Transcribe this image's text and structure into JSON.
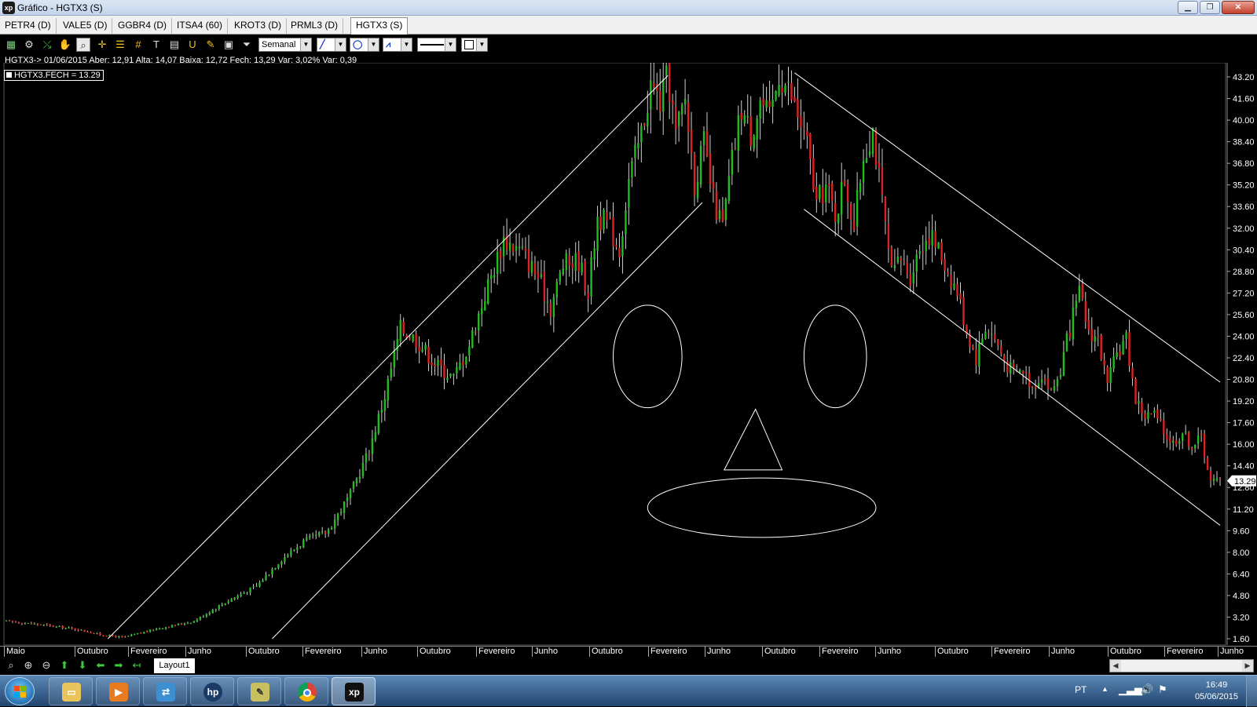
{
  "window": {
    "title": "Gráfico - HGTX3 (S)",
    "app_icon_text": "xp",
    "minimize_label": "▁",
    "restore_label": "❐",
    "close_label": "✕"
  },
  "tabs": [
    {
      "label": "PETR4 (D)"
    },
    {
      "label": "VALE5 (D)"
    },
    {
      "label": "GGBR4 (D)"
    },
    {
      "label": "ITSA4 (60)"
    },
    {
      "label": "KROT3 (D)"
    },
    {
      "label": "PRML3 (D)"
    },
    {
      "label": "HGTX3 (S)",
      "active": true
    }
  ],
  "toolbar": {
    "period_value": "Semanal",
    "tools": [
      "chart-type-icon",
      "settings-gear-icon",
      "indicator-icon",
      "pan-hand-icon",
      "magnifier-icon",
      "crosshair-icon",
      "fibonacci-icon",
      "grid-icon",
      "text-icon",
      "calculator-icon",
      "magnet-icon",
      "eraser-icon",
      "lock-icon",
      "filter-icon"
    ]
  },
  "info": {
    "quote_line": "HGTX3-> 01/06/2015 Aber: 12,91 Alta: 14,07 Baixa: 12,72 Fech: 13,29 Var: 3,02% Var: 0,39",
    "legend": "HGTX3.FECH = 13.29"
  },
  "chart_data": {
    "type": "candlestick",
    "symbol": "HGTX3",
    "period": "Semanal",
    "ylim": [
      1.6,
      43.2
    ],
    "y_ticks": [
      "43.20",
      "41.60",
      "40.00",
      "38.40",
      "36.80",
      "35.20",
      "33.60",
      "32.00",
      "30.40",
      "28.80",
      "27.20",
      "25.60",
      "24.00",
      "22.40",
      "20.80",
      "19.20",
      "17.60",
      "16.00",
      "14.40",
      "12.80",
      "11.20",
      "9.60",
      "8.00",
      "6.40",
      "4.80",
      "3.20",
      "1.60"
    ],
    "last_price": "13.29",
    "x_labels": [
      "Maio",
      "Outubro",
      "Fevereiro",
      "Junho",
      "Outubro",
      "Fevereiro",
      "Junho",
      "Outubro",
      "Fevereiro",
      "Junho",
      "Outubro",
      "Fevereiro",
      "Junho",
      "Outubro",
      "Fevereiro",
      "Junho",
      "Outubro",
      "Fevereiro",
      "Junho",
      "Outubro",
      "Fevereiro",
      "Junho"
    ],
    "up_color": "#22bb22",
    "down_color": "#dd2222",
    "line_color": "#ffffff",
    "price_path": [
      [
        0,
        2.9
      ],
      [
        25,
        2.6
      ],
      [
        45,
        2.3
      ],
      [
        60,
        1.9
      ],
      [
        75,
        1.7
      ],
      [
        95,
        2.3
      ],
      [
        120,
        2.9
      ],
      [
        140,
        4.3
      ],
      [
        160,
        5.5
      ],
      [
        175,
        7.4
      ],
      [
        190,
        8.8
      ],
      [
        205,
        9.5
      ],
      [
        220,
        12.3
      ],
      [
        232,
        15.6
      ],
      [
        242,
        19.6
      ],
      [
        252,
        24.6
      ],
      [
        262,
        23.8
      ],
      [
        274,
        22.0
      ],
      [
        286,
        20.9
      ],
      [
        296,
        23.4
      ],
      [
        306,
        27.1
      ],
      [
        318,
        31.2
      ],
      [
        330,
        30.2
      ],
      [
        340,
        28.4
      ],
      [
        348,
        26.1
      ],
      [
        356,
        29.3
      ],
      [
        366,
        29.6
      ],
      [
        372,
        27.3
      ],
      [
        378,
        32.9
      ],
      [
        385,
        32.2
      ],
      [
        392,
        30.4
      ],
      [
        398,
        35.6
      ],
      [
        405,
        38.5
      ],
      [
        412,
        42.6
      ],
      [
        418,
        41.3
      ],
      [
        423,
        43.3
      ],
      [
        428,
        38.9
      ],
      [
        434,
        41.6
      ],
      [
        440,
        35.4
      ],
      [
        446,
        38.2
      ],
      [
        452,
        34.0
      ],
      [
        458,
        32.1
      ],
      [
        464,
        37.0
      ],
      [
        470,
        40.9
      ],
      [
        476,
        39.0
      ],
      [
        482,
        41.5
      ],
      [
        488,
        40.0
      ],
      [
        494,
        43.5
      ],
      [
        500,
        42.3
      ],
      [
        506,
        40.4
      ],
      [
        512,
        38.1
      ],
      [
        518,
        33.8
      ],
      [
        524,
        35.1
      ],
      [
        530,
        33.0
      ],
      [
        536,
        35.7
      ],
      [
        542,
        32.1
      ],
      [
        548,
        37.5
      ],
      [
        554,
        39.4
      ],
      [
        560,
        33.8
      ],
      [
        566,
        28.5
      ],
      [
        572,
        29.7
      ],
      [
        578,
        28.5
      ],
      [
        584,
        30.6
      ],
      [
        590,
        31.6
      ],
      [
        596,
        30.4
      ],
      [
        602,
        28.8
      ],
      [
        608,
        27.3
      ],
      [
        614,
        24.4
      ],
      [
        620,
        22.4
      ],
      [
        626,
        24.7
      ],
      [
        632,
        23.8
      ],
      [
        638,
        22.2
      ],
      [
        644,
        21.2
      ],
      [
        650,
        21.5
      ],
      [
        656,
        20.3
      ],
      [
        662,
        21.3
      ],
      [
        668,
        19.8
      ],
      [
        674,
        21.5
      ],
      [
        680,
        24.6
      ],
      [
        686,
        27.1
      ],
      [
        692,
        24.4
      ],
      [
        698,
        23.8
      ],
      [
        704,
        20.3
      ],
      [
        710,
        22.7
      ],
      [
        716,
        23.8
      ],
      [
        722,
        19.3
      ],
      [
        728,
        18.1
      ],
      [
        734,
        18.2
      ],
      [
        740,
        16.9
      ],
      [
        746,
        16.1
      ],
      [
        752,
        16.9
      ],
      [
        758,
        15.9
      ],
      [
        764,
        16.5
      ],
      [
        770,
        13.2
      ],
      [
        776,
        13.3
      ]
    ],
    "annotations": [
      {
        "kind": "trend-line",
        "from": [
          65,
          1.6
        ],
        "to": [
          423,
          43.3
        ]
      },
      {
        "kind": "trend-line",
        "from": [
          170,
          1.6
        ],
        "to": [
          445,
          33.9
        ]
      },
      {
        "kind": "trend-line",
        "from": [
          504,
          43.5
        ],
        "to": [
          776,
          20.6
        ]
      },
      {
        "kind": "trend-line",
        "from": [
          510,
          33.4
        ],
        "to": [
          776,
          10.0
        ]
      },
      {
        "kind": "ellipse",
        "center": [
          410,
          22.5
        ],
        "rx": 22,
        "ry": 3.8
      },
      {
        "kind": "ellipse",
        "center": [
          530,
          22.5
        ],
        "rx": 20,
        "ry": 3.8
      },
      {
        "kind": "triangle",
        "points": [
          [
            459,
            14.1
          ],
          [
            479,
            18.6
          ],
          [
            496,
            14.1
          ]
        ]
      },
      {
        "kind": "ellipse",
        "center": [
          483,
          11.3
        ],
        "rx": 73,
        "ry": 2.2
      }
    ]
  },
  "bottom": {
    "layout_tab": "Layout1",
    "nav_tools": [
      "zoom-icon",
      "zoom-in-icon",
      "zoom-out-icon",
      "arrow-up-icon",
      "arrow-down-icon",
      "arrow-left-icon",
      "arrow-right-icon",
      "arrow-left-end-icon"
    ]
  },
  "taskbar": {
    "apps": [
      "explorer-icon",
      "media-player-icon",
      "network-icon",
      "hp-icon",
      "notepad-icon",
      "chrome-icon",
      "xp-app-icon"
    ],
    "active_app": "xp-app-icon",
    "language": "PT",
    "time": "16:49",
    "date": "05/06/2015"
  }
}
